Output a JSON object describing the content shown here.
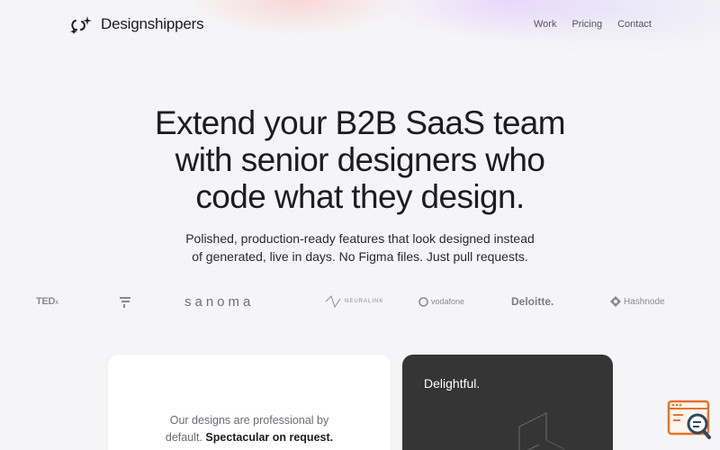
{
  "nav": {
    "brand": "Designshippers",
    "links": [
      "Work",
      "Pricing",
      "Contact"
    ]
  },
  "hero": {
    "title_lines": [
      "Extend your B2B SaaS team",
      "with senior designers who",
      "code what they design."
    ],
    "subtitle_lines": [
      "Polished, production-ready features that look designed instead",
      "of generated, live in days. No Figma files. Just pull requests."
    ]
  },
  "logos": {
    "ted": "TED",
    "ted_suffix": "x",
    "sanoma": "sanoma",
    "neuralink": "NEURALINK",
    "vodafone": "vodafone",
    "deloitte": "Deloitte.",
    "hashnode": "Hashnode"
  },
  "cards": {
    "light_text": "Our designs are professional by",
    "light_text_2": "default.",
    "light_text_bold": "Spectacular on request.",
    "dark_title": "Delightful."
  },
  "colors": {
    "background": "#f5f5f7",
    "dark_card": "#353536",
    "widget_accent": "#e8732c"
  }
}
